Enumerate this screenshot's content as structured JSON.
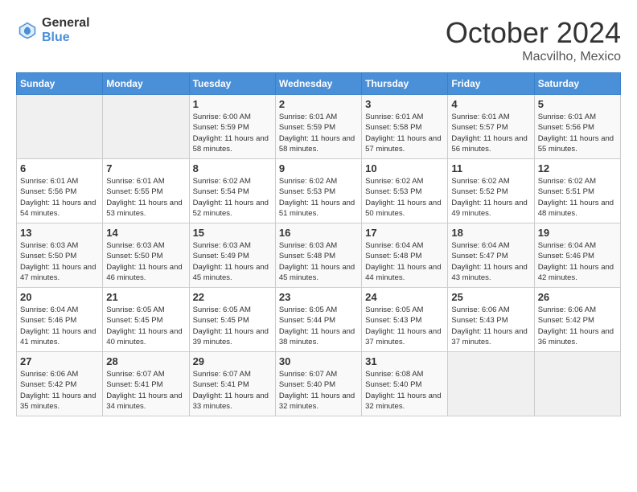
{
  "logo": {
    "general": "General",
    "blue": "Blue"
  },
  "title": "October 2024",
  "location": "Macvilho, Mexico",
  "days_header": [
    "Sunday",
    "Monday",
    "Tuesday",
    "Wednesday",
    "Thursday",
    "Friday",
    "Saturday"
  ],
  "weeks": [
    [
      {
        "day": "",
        "empty": true
      },
      {
        "day": "",
        "empty": true
      },
      {
        "day": "1",
        "sunrise": "6:00 AM",
        "sunset": "5:59 PM",
        "daylight": "11 hours and 58 minutes."
      },
      {
        "day": "2",
        "sunrise": "6:01 AM",
        "sunset": "5:59 PM",
        "daylight": "11 hours and 58 minutes."
      },
      {
        "day": "3",
        "sunrise": "6:01 AM",
        "sunset": "5:58 PM",
        "daylight": "11 hours and 57 minutes."
      },
      {
        "day": "4",
        "sunrise": "6:01 AM",
        "sunset": "5:57 PM",
        "daylight": "11 hours and 56 minutes."
      },
      {
        "day": "5",
        "sunrise": "6:01 AM",
        "sunset": "5:56 PM",
        "daylight": "11 hours and 55 minutes."
      }
    ],
    [
      {
        "day": "6",
        "sunrise": "6:01 AM",
        "sunset": "5:56 PM",
        "daylight": "11 hours and 54 minutes."
      },
      {
        "day": "7",
        "sunrise": "6:01 AM",
        "sunset": "5:55 PM",
        "daylight": "11 hours and 53 minutes."
      },
      {
        "day": "8",
        "sunrise": "6:02 AM",
        "sunset": "5:54 PM",
        "daylight": "11 hours and 52 minutes."
      },
      {
        "day": "9",
        "sunrise": "6:02 AM",
        "sunset": "5:53 PM",
        "daylight": "11 hours and 51 minutes."
      },
      {
        "day": "10",
        "sunrise": "6:02 AM",
        "sunset": "5:53 PM",
        "daylight": "11 hours and 50 minutes."
      },
      {
        "day": "11",
        "sunrise": "6:02 AM",
        "sunset": "5:52 PM",
        "daylight": "11 hours and 49 minutes."
      },
      {
        "day": "12",
        "sunrise": "6:02 AM",
        "sunset": "5:51 PM",
        "daylight": "11 hours and 48 minutes."
      }
    ],
    [
      {
        "day": "13",
        "sunrise": "6:03 AM",
        "sunset": "5:50 PM",
        "daylight": "11 hours and 47 minutes."
      },
      {
        "day": "14",
        "sunrise": "6:03 AM",
        "sunset": "5:50 PM",
        "daylight": "11 hours and 46 minutes."
      },
      {
        "day": "15",
        "sunrise": "6:03 AM",
        "sunset": "5:49 PM",
        "daylight": "11 hours and 45 minutes."
      },
      {
        "day": "16",
        "sunrise": "6:03 AM",
        "sunset": "5:48 PM",
        "daylight": "11 hours and 45 minutes."
      },
      {
        "day": "17",
        "sunrise": "6:04 AM",
        "sunset": "5:48 PM",
        "daylight": "11 hours and 44 minutes."
      },
      {
        "day": "18",
        "sunrise": "6:04 AM",
        "sunset": "5:47 PM",
        "daylight": "11 hours and 43 minutes."
      },
      {
        "day": "19",
        "sunrise": "6:04 AM",
        "sunset": "5:46 PM",
        "daylight": "11 hours and 42 minutes."
      }
    ],
    [
      {
        "day": "20",
        "sunrise": "6:04 AM",
        "sunset": "5:46 PM",
        "daylight": "11 hours and 41 minutes."
      },
      {
        "day": "21",
        "sunrise": "6:05 AM",
        "sunset": "5:45 PM",
        "daylight": "11 hours and 40 minutes."
      },
      {
        "day": "22",
        "sunrise": "6:05 AM",
        "sunset": "5:45 PM",
        "daylight": "11 hours and 39 minutes."
      },
      {
        "day": "23",
        "sunrise": "6:05 AM",
        "sunset": "5:44 PM",
        "daylight": "11 hours and 38 minutes."
      },
      {
        "day": "24",
        "sunrise": "6:05 AM",
        "sunset": "5:43 PM",
        "daylight": "11 hours and 37 minutes."
      },
      {
        "day": "25",
        "sunrise": "6:06 AM",
        "sunset": "5:43 PM",
        "daylight": "11 hours and 37 minutes."
      },
      {
        "day": "26",
        "sunrise": "6:06 AM",
        "sunset": "5:42 PM",
        "daylight": "11 hours and 36 minutes."
      }
    ],
    [
      {
        "day": "27",
        "sunrise": "6:06 AM",
        "sunset": "5:42 PM",
        "daylight": "11 hours and 35 minutes."
      },
      {
        "day": "28",
        "sunrise": "6:07 AM",
        "sunset": "5:41 PM",
        "daylight": "11 hours and 34 minutes."
      },
      {
        "day": "29",
        "sunrise": "6:07 AM",
        "sunset": "5:41 PM",
        "daylight": "11 hours and 33 minutes."
      },
      {
        "day": "30",
        "sunrise": "6:07 AM",
        "sunset": "5:40 PM",
        "daylight": "11 hours and 32 minutes."
      },
      {
        "day": "31",
        "sunrise": "6:08 AM",
        "sunset": "5:40 PM",
        "daylight": "11 hours and 32 minutes."
      },
      {
        "day": "",
        "empty": true
      },
      {
        "day": "",
        "empty": true
      }
    ]
  ]
}
